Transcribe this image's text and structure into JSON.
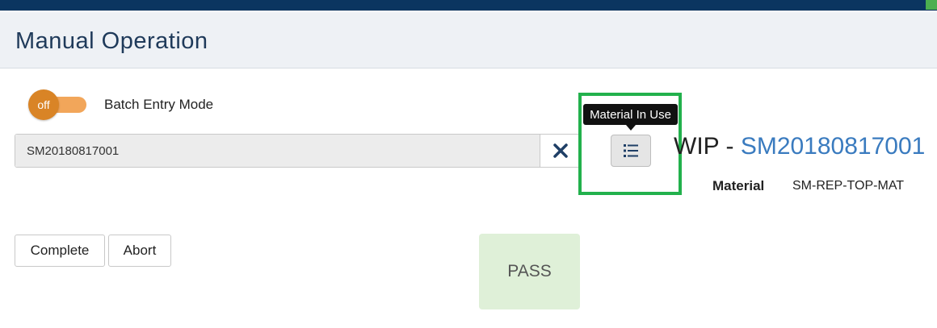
{
  "header": {
    "title": "Manual Operation"
  },
  "batch_entry": {
    "toggle_state": "off",
    "label": "Batch Entry Mode"
  },
  "wip_search": {
    "value": "SM20180817001",
    "clear_icon": "close-icon"
  },
  "material_in_use": {
    "tooltip": "Material In Use",
    "icon": "list-icon"
  },
  "wip": {
    "prefix": "WIP",
    "separator": "-",
    "id": "SM20180817001"
  },
  "material": {
    "label": "Material",
    "value": "SM-REP-TOP-MAT"
  },
  "actions": {
    "complete_label": "Complete",
    "abort_label": "Abort"
  },
  "status": {
    "result": "PASS"
  },
  "colors": {
    "topbar": "#0b3560",
    "toggle_knob": "#d98426",
    "toggle_track": "#f2a65a",
    "highlight": "#22b14c",
    "link": "#3a7bbf",
    "pass_bg": "#dff0d8"
  }
}
